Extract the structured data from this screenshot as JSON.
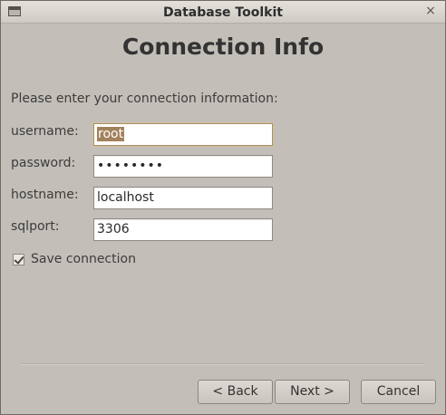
{
  "window": {
    "title": "Database Toolkit",
    "close_glyph": "×"
  },
  "heading": "Connection Info",
  "intro": "Please enter your connection information:",
  "fields": [
    {
      "label": "username:",
      "value": "root"
    },
    {
      "label": "password:",
      "value": "••••••••"
    },
    {
      "label": "hostname:",
      "value": "localhost"
    },
    {
      "label": "sqlport:",
      "value": "3306"
    }
  ],
  "save_connection": {
    "label": "Save connection",
    "checked": true
  },
  "buttons": {
    "back": "< Back",
    "next": "Next >",
    "cancel": "Cancel"
  },
  "colors": {
    "window_bg": "#c3bfb8",
    "selection": "#a2825c",
    "focus_ring": "#a88f68"
  },
  "icons": {
    "window_menu": "window-menu-icon",
    "close": "close-icon",
    "checkbox_mark": "checkmark-icon"
  }
}
